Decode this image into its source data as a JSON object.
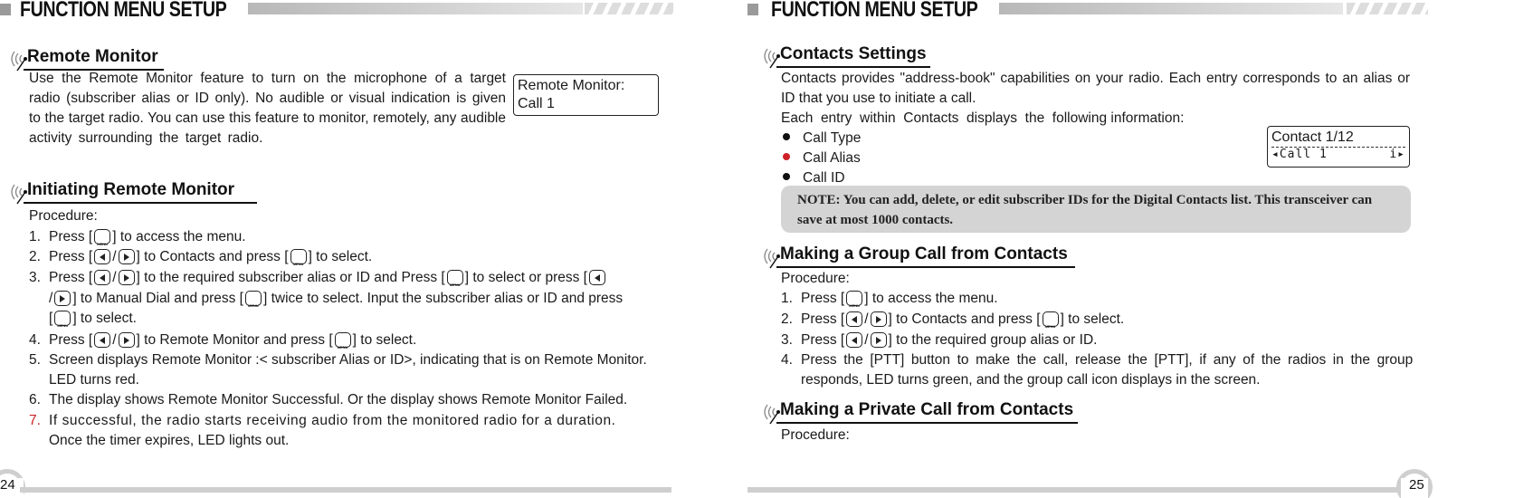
{
  "header": {
    "title": "FUNCTION MENU SETUP"
  },
  "left_page": {
    "page_number": "24",
    "remote_monitor": {
      "heading": "Remote Monitor",
      "paragraph_lines": [
        "Use the Remote Monitor feature to turn on the microphone of a target",
        "radio (subscriber alias or ID only). No audible or visual indication is given",
        "to the target radio. You can use this feature to monitor, remotely, any audible",
        "activity surrounding the target radio."
      ],
      "lcd": {
        "line1": "Remote Monitor:",
        "line2": "Call 1"
      }
    },
    "initiating": {
      "heading": "Initiating Remote Monitor",
      "procedure_label": "Procedure:",
      "steps": [
        {
          "num": "1.",
          "pre": "Press [",
          "post": "] to access the menu."
        },
        {
          "num": "2.",
          "pre": "Press [",
          "mid": "] to Contacts and press [",
          "post": "] to select."
        },
        {
          "num": "3.",
          "pre": "Press [",
          "mid": "] to the required subscriber alias or ID and Press [",
          "mid2": "] to select or press [",
          "line2_mid": "] to Manual Dial and press [",
          "line2_post": "] twice to select. Input the subscriber alias or ID and press",
          "line3_pre": "[",
          "line3_post": "] to select."
        },
        {
          "num": "4.",
          "pre": "Press [",
          "mid": "] to Remote Monitor and press [",
          "post": "] to select."
        },
        {
          "num": "5.",
          "line1": "Screen displays Remote Monitor :< subscriber Alias or ID>,  indicating that is on Remote Monitor.",
          "line2": "LED turns red."
        },
        {
          "num": "6.",
          "line1": "The display shows Remote Monitor Successful. Or the display shows Remote Monitor Failed."
        },
        {
          "num": "7.",
          "line1": "If successful, the radio starts receiving audio from the monitored radio for a duration.",
          "line2": "Once the timer expires, LED lights out."
        }
      ]
    }
  },
  "right_page": {
    "page_number": "25",
    "contacts_settings": {
      "heading": "Contacts Settings",
      "lines": [
        "Contacts provides \"address-book\" capabilities on your radio. Each entry corresponds to an alias or",
        "ID that you use to initiate a call.",
        "Each  entry  within  Contacts  displays  the  following information:"
      ],
      "bullets": [
        "Call Type",
        "Call Alias",
        "Call ID"
      ],
      "lcd": {
        "line1": "Contact 1/12",
        "line2_left": "◂Call 1",
        "line2_right": "i▸"
      },
      "note": "NOTE: You can add, delete, or edit subscriber IDs for the Digital Contacts list. This transceiver can save at most 1000 contacts."
    },
    "group_call": {
      "heading": "Making a Group Call from Contacts",
      "procedure_label": "Procedure:",
      "steps": [
        {
          "num": "1.",
          "pre": "Press [",
          "post": "] to access the menu."
        },
        {
          "num": "2.",
          "pre": "Press [",
          "mid": "] to Contacts and press [",
          "post": "] to select."
        },
        {
          "num": "3.",
          "pre": "Press [",
          "post": "] to the required group alias or ID."
        },
        {
          "num": "4.",
          "line1": "Press the [PTT] button to make the call, release the [PTT], if any of the radios in the group",
          "line2": "responds, LED turns green, and the group call icon displays in the screen."
        }
      ]
    },
    "private_call": {
      "heading": "Making a Private Call from Contacts",
      "procedure_label": "Procedure:"
    }
  }
}
